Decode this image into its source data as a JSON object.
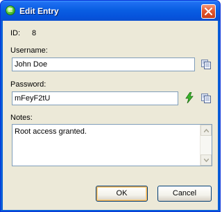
{
  "window": {
    "title": "Edit Entry"
  },
  "form": {
    "id_label": "ID:",
    "id_value": "8",
    "username_label": "Username:",
    "username_value": "John Doe",
    "password_label": "Password:",
    "password_value": "mFeyF2tU",
    "notes_label": "Notes:",
    "notes_value": "Root access granted."
  },
  "buttons": {
    "ok": "OK",
    "cancel": "Cancel"
  },
  "icons": {
    "title": "green-app-icon",
    "close": "close-icon",
    "copy_username": "copy-icon",
    "generate_password": "lightning-icon",
    "copy_password": "copy-icon"
  },
  "colors": {
    "titlebar": "#0a5fe3",
    "dialog_bg": "#ece9d8",
    "field_border": "#7f9db9",
    "close_button": "#e4582f",
    "lightning": "#2fa51b"
  }
}
